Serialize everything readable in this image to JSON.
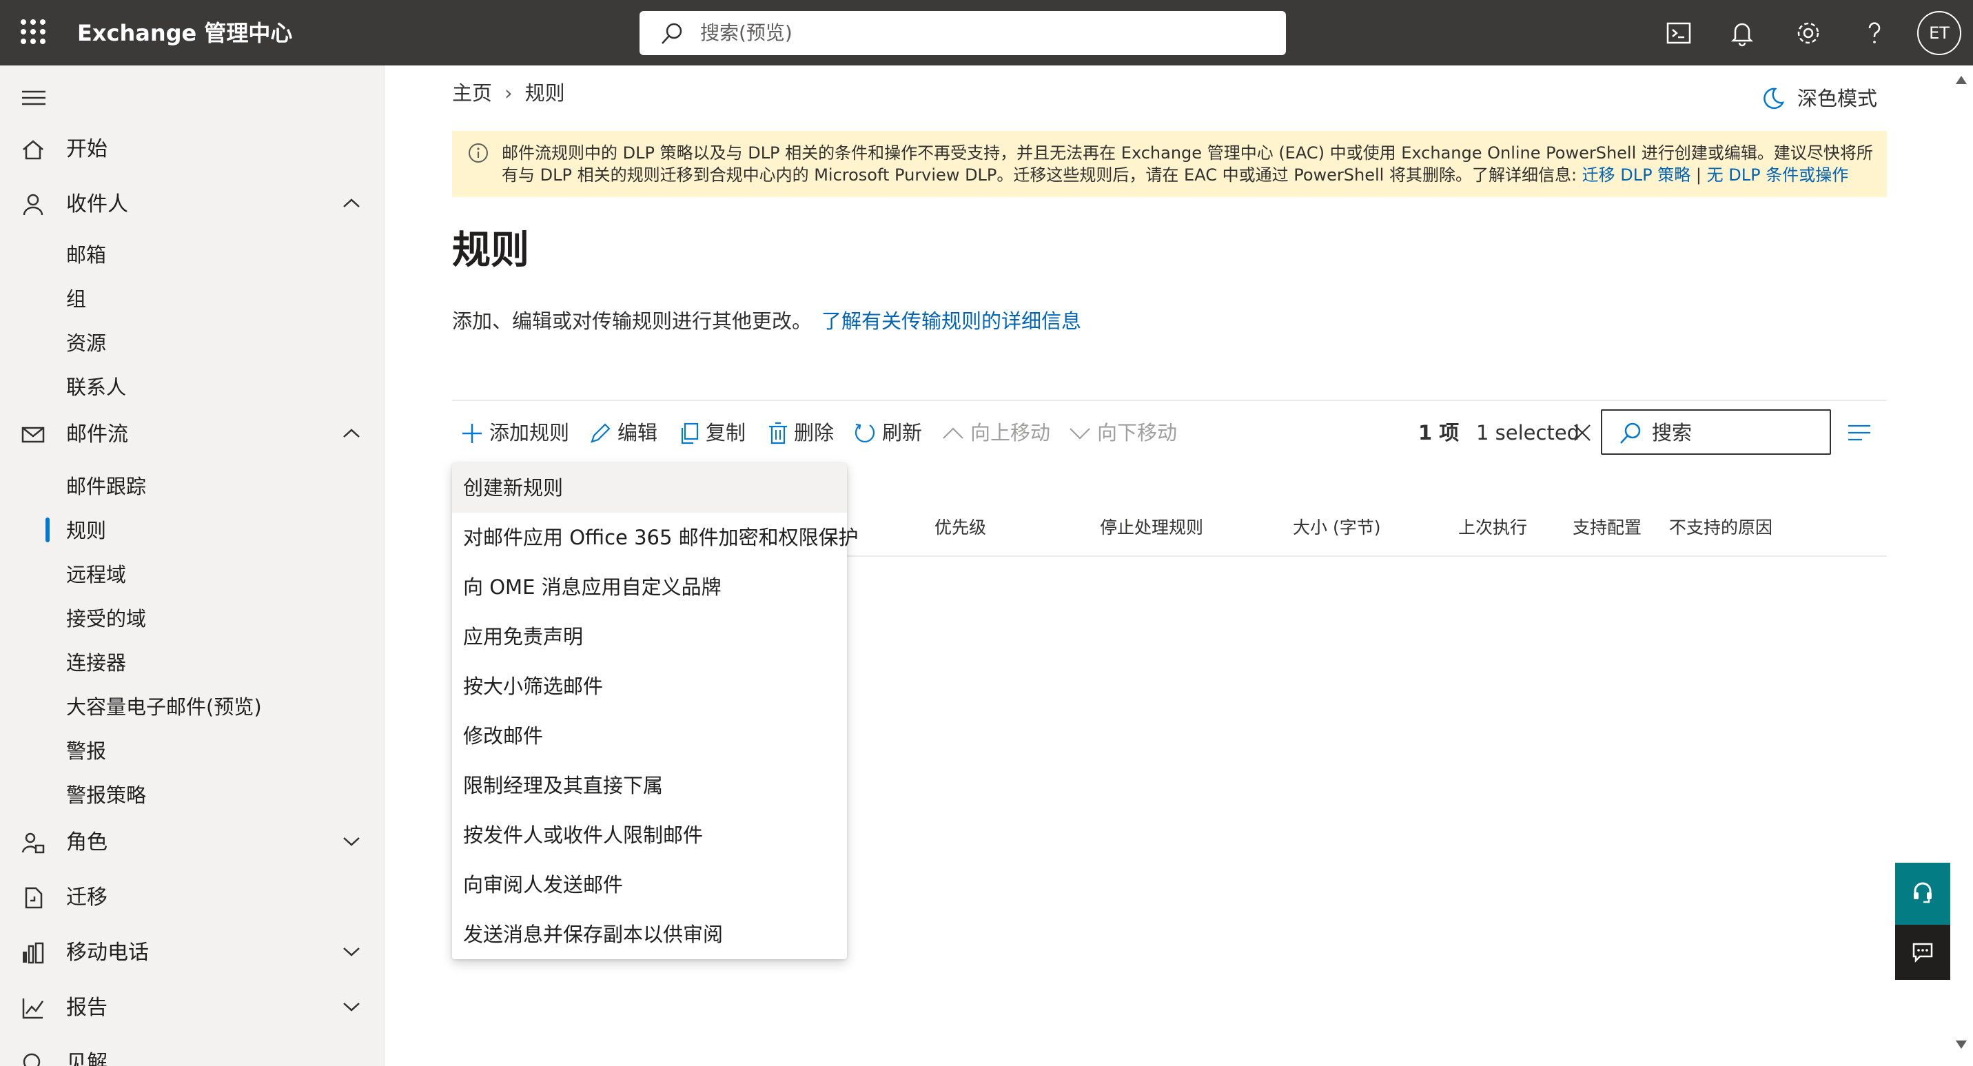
{
  "header": {
    "app_title": "Exchange 管理中心",
    "search_placeholder": "搜索(预览)",
    "avatar_initials": "ET",
    "icons": [
      "waffle-icon",
      "terminal-icon",
      "bell-icon",
      "gear-icon",
      "help-icon"
    ]
  },
  "sidebar": {
    "items": [
      {
        "label": "开始",
        "icon": "home-icon"
      },
      {
        "label": "收件人",
        "icon": "person-icon",
        "expanded": true
      },
      {
        "label": "邮箱"
      },
      {
        "label": "组"
      },
      {
        "label": "资源"
      },
      {
        "label": "联系人"
      },
      {
        "label": "邮件流",
        "icon": "mail-icon",
        "expanded": true
      },
      {
        "label": "邮件跟踪"
      },
      {
        "label": "规则",
        "active": true
      },
      {
        "label": "远程域"
      },
      {
        "label": "接受的域"
      },
      {
        "label": "连接器"
      },
      {
        "label": "大容量电子邮件(预览)"
      },
      {
        "label": "警报"
      },
      {
        "label": "警报策略"
      },
      {
        "label": "角色",
        "icon": "roles-icon",
        "expanded": false
      },
      {
        "label": "迁移",
        "icon": "migration-icon"
      },
      {
        "label": "移动电话",
        "icon": "mobile-icon",
        "expanded": false
      },
      {
        "label": "报告",
        "icon": "chart-icon",
        "expanded": false
      },
      {
        "label": "见解",
        "icon": "insights-icon"
      }
    ]
  },
  "breadcrumb": {
    "home": "主页",
    "current": "规则"
  },
  "dark_mode_label": "深色模式",
  "banner": {
    "text": "邮件流规则中的 DLP 策略以及与 DLP 相关的条件和操作不再受支持，并且无法再在 Exchange 管理中心 (EAC) 中或使用 Exchange Online PowerShell 进行创建或编辑。建议尽快将所有与 DLP 相关的规则迁移到合规中心内的 Microsoft Purview DLP。迁移这些规则后，请在 EAC 中或通过 PowerShell 将其删除。了解详细信息: ",
    "link1": "迁移 DLP 策略",
    "separator": "|",
    "link2": "无 DLP 条件或操作"
  },
  "page": {
    "title": "规则",
    "description": "添加、编辑或对传输规则进行其他更改。",
    "learn_more": "了解有关传输规则的详细信息"
  },
  "toolbar": {
    "add_rule": "添加规则",
    "edit": "编辑",
    "copy": "复制",
    "delete": "删除",
    "refresh": "刷新",
    "move_up": "向上移动",
    "move_down": "向下移动",
    "count": "1 项",
    "selected": "1 selected",
    "search": "搜索"
  },
  "columns": [
    "优先级",
    "停止处理规则",
    "大小 (字节)",
    "上次执行",
    "支持配置",
    "不支持的原因"
  ],
  "menu": {
    "items": [
      "创建新规则",
      "对邮件应用 Office 365 邮件加密和权限保护",
      "向 OME 消息应用自定义品牌",
      "应用免责声明",
      "按大小筛选邮件",
      "修改邮件",
      "限制经理及其直接下属",
      "按发件人或收件人限制邮件",
      "向审阅人发送邮件",
      "发送消息并保存副本以供审阅"
    ]
  },
  "colors": {
    "topbar": "#3b3a39",
    "accent": "#0078d4",
    "banner": "#fff4ce",
    "help_fab": "#037c84"
  }
}
